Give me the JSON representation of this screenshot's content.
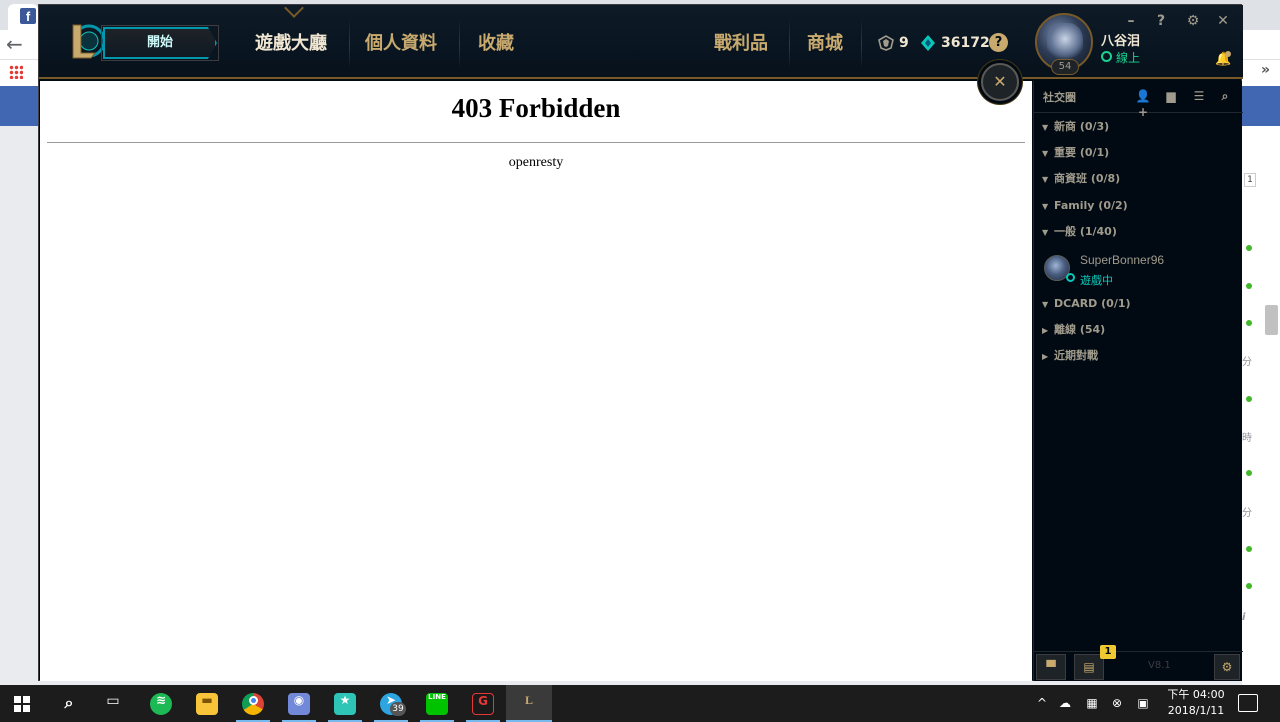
{
  "background_browser": {
    "facebook_icon": "f",
    "bookmark_more": "»",
    "sidebar_badge": "1",
    "side_texts": [
      "分",
      "時",
      "分",
      "i"
    ]
  },
  "client": {
    "play_button": "開始",
    "nav": {
      "home": "遊戲大廳",
      "profile": "個人資料",
      "collection": "收藏",
      "loot": "戰利品",
      "store": "商城"
    },
    "currency": {
      "blue_essence": "9",
      "riot_points": "36172",
      "help": "?"
    },
    "summoner": {
      "name": "八谷泪",
      "status": "線上",
      "level": "54"
    },
    "window_controls": {
      "minimize": "–",
      "help": "?",
      "settings": "⚙",
      "close": "✕"
    }
  },
  "content": {
    "title": "403 Forbidden",
    "server": "openresty",
    "close": "✕"
  },
  "social": {
    "title": "社交圈",
    "groups": [
      {
        "label": "新商 (0/3)",
        "expanded": true
      },
      {
        "label": "重要 (0/1)",
        "expanded": true
      },
      {
        "label": "商資班 (0/8)",
        "expanded": true
      },
      {
        "label": "Family (0/2)",
        "expanded": true
      },
      {
        "label": "一般 (1/40)",
        "expanded": true
      },
      {
        "label": "DCARD (0/1)",
        "expanded": true
      },
      {
        "label": "離線 (54)",
        "expanded": false
      },
      {
        "label": "近期對戰",
        "expanded": false
      }
    ],
    "friend": {
      "name": "SuperBonner96",
      "status": "遊戲中"
    },
    "footer": {
      "notification_count": "1",
      "version": "V8.1"
    }
  },
  "taskbar": {
    "telegram_count": "39",
    "clock_time": "下午 04:00",
    "clock_date": "2018/1/11",
    "line_label": "LINE"
  },
  "colors": {
    "gold": "#c8aa6e",
    "teal": "#0ac8b9",
    "online": "#1ad28f",
    "client_bg": "#010a13"
  }
}
